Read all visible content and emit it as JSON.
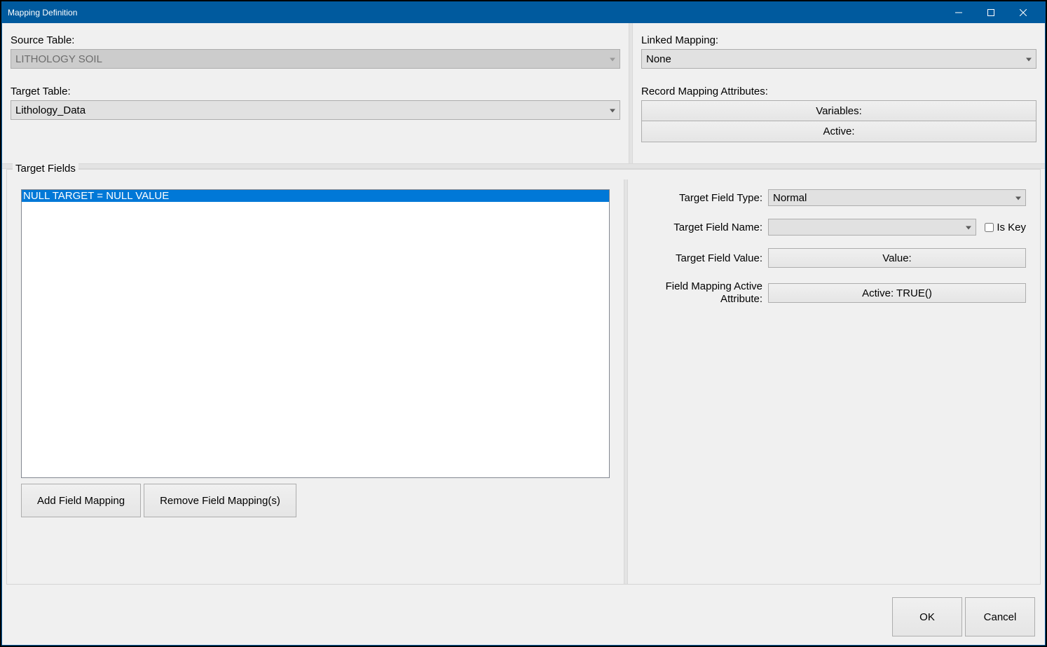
{
  "window": {
    "title": "Mapping Definition"
  },
  "sourceTable": {
    "label": "Source Table:",
    "value": "LITHOLOGY SOIL"
  },
  "targetTable": {
    "label": "Target Table:",
    "value": "Lithology_Data"
  },
  "linkedMapping": {
    "label": "Linked Mapping:",
    "value": "None"
  },
  "recordMappingAttributes": {
    "label": "Record Mapping Attributes:",
    "variables": "Variables:",
    "active": "Active:"
  },
  "targetFields": {
    "groupTitle": "Target Fields",
    "listItems": [
      "NULL TARGET = NULL VALUE"
    ],
    "addBtn": "Add Field Mapping",
    "removeBtn": "Remove Field Mapping(s)"
  },
  "fieldDetail": {
    "typeLabel": "Target Field Type:",
    "typeValue": "Normal",
    "nameLabel": "Target Field Name:",
    "nameValue": "",
    "isKeyLabel": "Is Key",
    "valueLabel": "Target Field Value:",
    "valueBtn": "Value:",
    "activeLabel": "Field Mapping Active Attribute:",
    "activeBtn": "Active: TRUE()"
  },
  "footer": {
    "ok": "OK",
    "cancel": "Cancel"
  }
}
